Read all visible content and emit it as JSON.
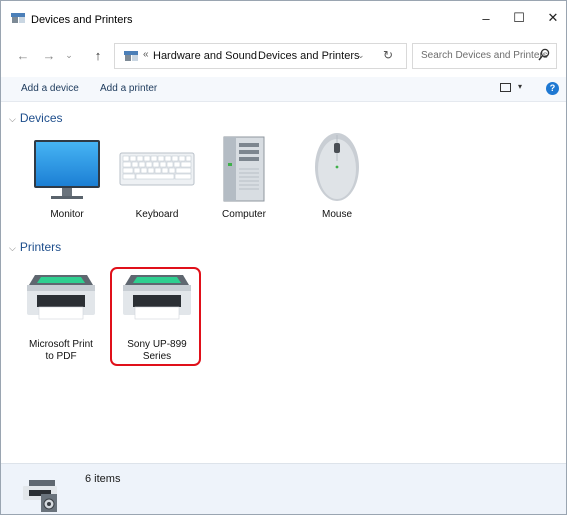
{
  "window": {
    "title": "Devices and Printers",
    "controls": {
      "minimize": "–",
      "maximize": "☐",
      "close": "✕"
    }
  },
  "address_bar": {
    "back": "←",
    "forward": "→",
    "history_dropdown": "⌄",
    "up": "↑",
    "overflow": "«",
    "crumbs": [
      "Hardware and Sound",
      "Devices and Printers"
    ],
    "separator": "›",
    "dropdown": "⌄",
    "refresh": "↻"
  },
  "search": {
    "placeholder": "Search Devices and Printers"
  },
  "command_bar": {
    "add_device": "Add a device",
    "add_printer": "Add a printer",
    "view_dropdown": "▾",
    "help": "?"
  },
  "groups": {
    "devices": {
      "label": "Devices",
      "chevron": "⌵",
      "items": [
        {
          "name": "Monitor",
          "icon": "monitor-icon"
        },
        {
          "name": "Keyboard",
          "icon": "keyboard-icon"
        },
        {
          "name": "Computer",
          "icon": "computer-icon"
        },
        {
          "name": "Mouse",
          "icon": "mouse-icon"
        }
      ]
    },
    "printers": {
      "label": "Printers",
      "chevron": "⌵",
      "items": [
        {
          "name_line1": "Microsoft Print",
          "name_line2": "to PDF",
          "icon": "printer-icon"
        },
        {
          "name_line1": "Sony UP-899",
          "name_line2": "Series",
          "icon": "printer-icon",
          "selected": true
        }
      ]
    }
  },
  "status": {
    "count_text": "6 items"
  },
  "colors": {
    "selection_outline": "#e0101a",
    "accent": "#1e78d2",
    "link_blue": "#1e4e8c"
  }
}
